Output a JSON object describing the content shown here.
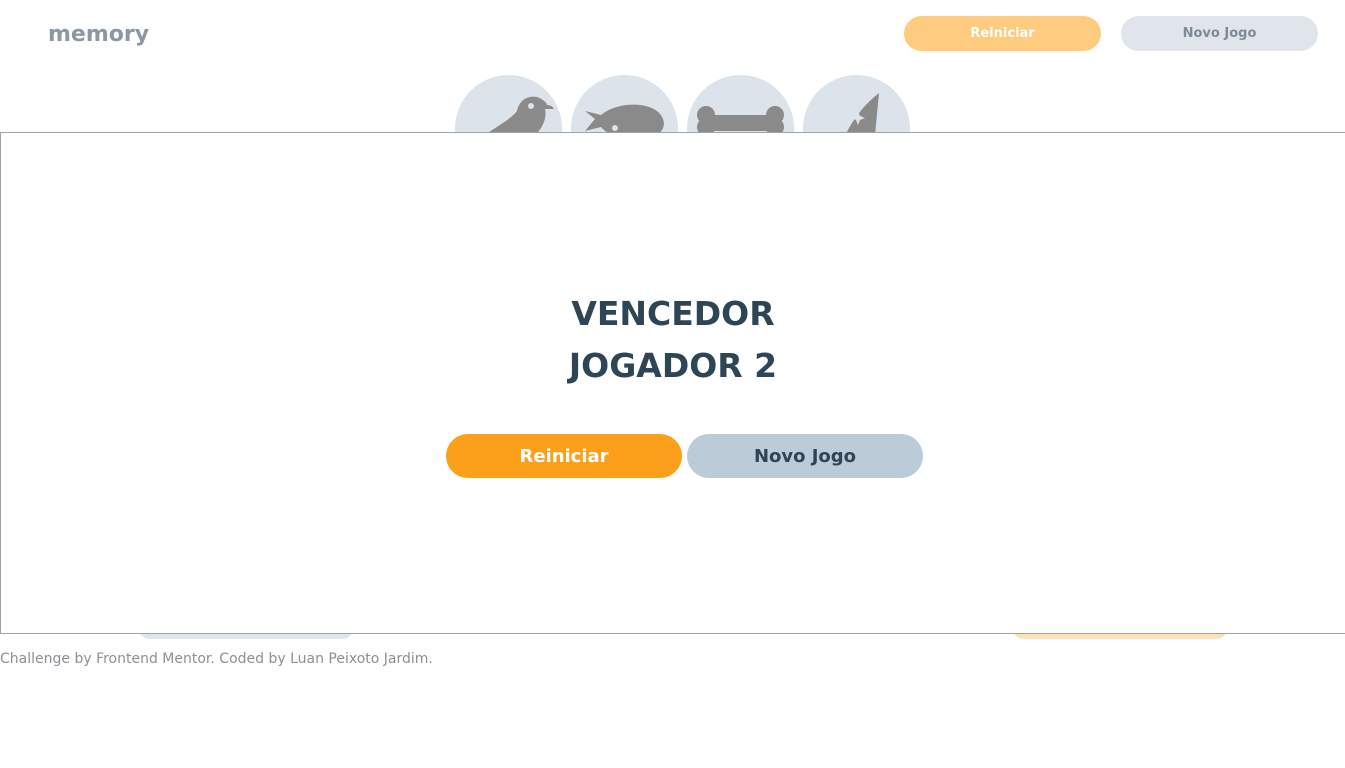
{
  "header": {
    "logo": "memory",
    "restart_label": "Reiniciar",
    "new_game_label": "Novo Jogo"
  },
  "board": {
    "tiles": [
      {
        "icon": "bird-icon"
      },
      {
        "icon": "fish-icon"
      },
      {
        "icon": "bone-icon"
      },
      {
        "icon": "magic-hat-icon"
      }
    ]
  },
  "modal": {
    "title": "VENCEDOR",
    "winner": "JOGADOR 2",
    "restart_label": "Reiniciar",
    "new_game_label": "Novo Jogo"
  },
  "footer": {
    "credit": "Challenge by Frontend Mentor. Coded by Luan Peixoto Jardim."
  },
  "colors": {
    "accent": "#fca01a",
    "accent_light": "#fecb7f",
    "secondary": "#bbcbd8",
    "dark_text": "#2e4556",
    "tile": "#dce3ea",
    "icon": "#8a8a8a"
  }
}
